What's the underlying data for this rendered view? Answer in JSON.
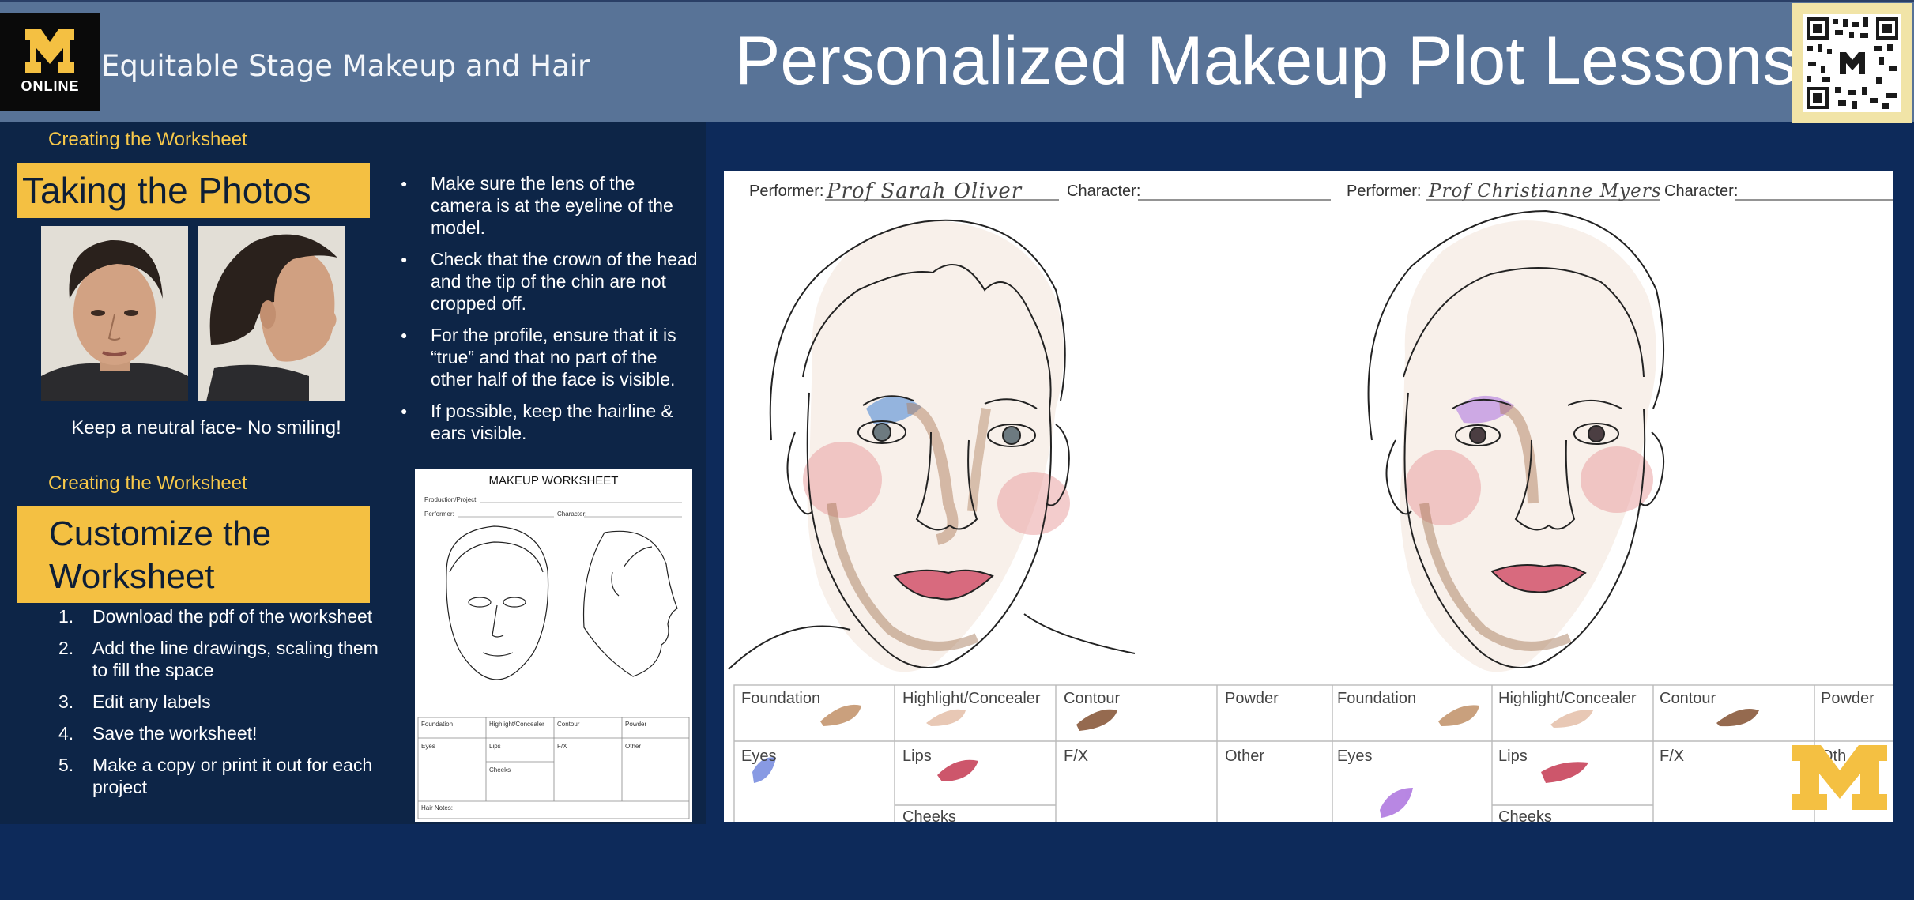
{
  "header": {
    "logo_text": "ONLINE",
    "course": "Equitable Stage Makeup and Hair",
    "title": "Personalized Makeup Plot Lessons"
  },
  "section1": {
    "kicker": "Creating the Worksheet",
    "heading": "Taking the Photos",
    "caption": "Keep a neutral face- No smiling!"
  },
  "tips": [
    "Make sure the lens of the camera is at the eyeline of the model.",
    "Check that the crown of the head and the tip of the chin are not cropped off.",
    "For the profile, ensure that it is “true” and that no part of the other half of the face is visible.",
    "If possible, keep the hairline & ears visible."
  ],
  "section2": {
    "kicker": "Creating the Worksheet",
    "heading": "Customize the Worksheet",
    "steps": [
      {
        "n": "1.",
        "text": "Download the pdf of the worksheet"
      },
      {
        "n": "2.",
        "text": "Add the line drawings, scaling them to fill the space"
      },
      {
        "n": "3.",
        "text": "Edit any labels"
      },
      {
        "n": "4.",
        "text": "Save the worksheet!"
      },
      {
        "n": "5.",
        "text": "Make a copy or print it out for each project"
      }
    ]
  },
  "worksheet": {
    "title": "MAKEUP WORKSHEET",
    "production": "Production/Project:",
    "performer": "Performer:",
    "character": "Character:",
    "table": [
      "Foundation",
      "Highlight/Concealer",
      "Contour",
      "Powder",
      "Eyes",
      "Lips",
      "F/X",
      "Other",
      "Cheeks"
    ],
    "hair_notes": "Hair Notes:"
  },
  "plot": {
    "performer_label": "Performer:",
    "character_label": "Character:",
    "performer1": "Prof Sarah Oliver",
    "performer2": "Prof Christianne Myers",
    "row1": [
      "Foundation",
      "Highlight/Concealer",
      "Contour",
      "Powder",
      "Foundation",
      "Highlight/Concealer",
      "Contour",
      "Powder"
    ],
    "row2": [
      "Eyes",
      "Lips",
      "F/X",
      "Other",
      "Eyes",
      "Lips",
      "F/X",
      "Oth"
    ],
    "row3": [
      "Cheeks",
      "Cheeks"
    ]
  },
  "colors": {
    "background": "#0d2a5a",
    "topbar": "#587397",
    "accent": "#f4c042",
    "foundation": "#c4966f",
    "highlight": "#e6c3ad",
    "contour": "#8a5a3c",
    "lips": "#c8445b",
    "eyes1": "#7b8fe0",
    "eyes2": "#b07ae0"
  }
}
